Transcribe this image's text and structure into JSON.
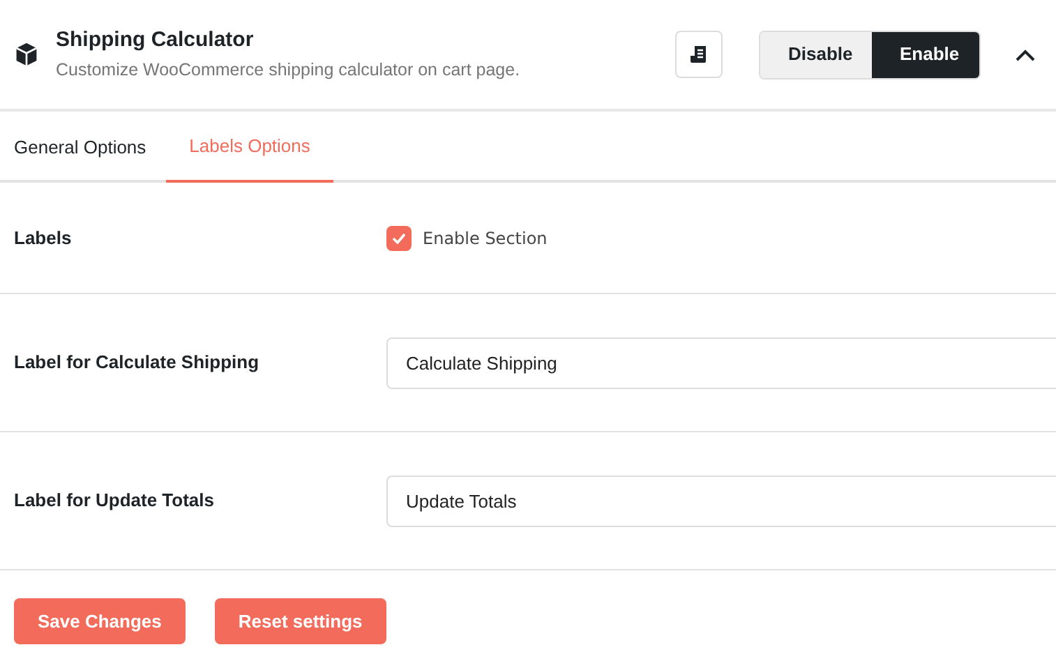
{
  "header": {
    "title": "Shipping Calculator",
    "subtitle": "Customize WooCommerce shipping calculator on cart page.",
    "toggle": [
      {
        "label": "Disable",
        "selected": false
      },
      {
        "label": "Enable",
        "selected": true
      }
    ],
    "expanded": true
  },
  "tabs": [
    {
      "label": "General Options",
      "selected": false
    },
    {
      "label": "Labels Options",
      "selected": true
    }
  ],
  "rows": [
    {
      "kind": "checkbox",
      "label": "Labels",
      "option": "Enable Section",
      "checked": true
    },
    {
      "kind": "text",
      "label": "Label for Calculate Shipping",
      "value": "Calculate Shipping"
    },
    {
      "kind": "text",
      "label": "Label for Update Totals",
      "value": "Update Totals"
    }
  ],
  "buttons": [
    "Save Changes",
    "Reset settings"
  ]
}
